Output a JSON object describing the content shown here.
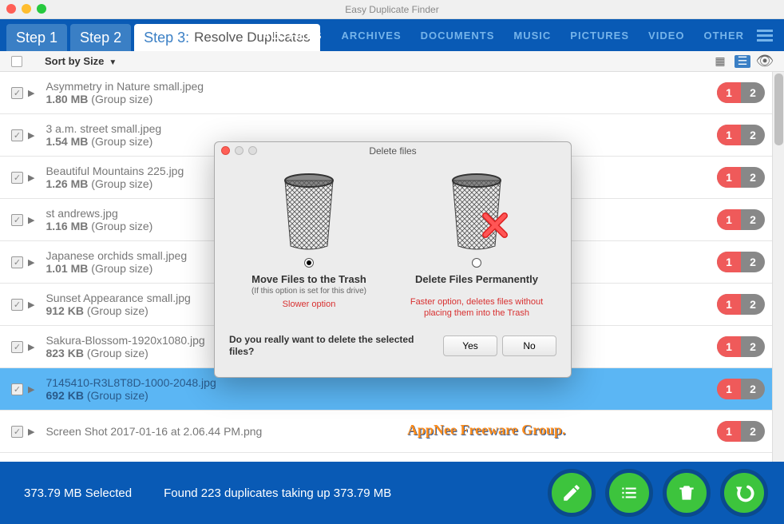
{
  "app_title": "Easy Duplicate Finder",
  "steps": [
    {
      "label": "Step 1"
    },
    {
      "label": "Step 2"
    },
    {
      "label": "Step 3:",
      "sublabel": "Resolve Duplicates",
      "active": true
    }
  ],
  "categories": [
    "ALL FILES",
    "ARCHIVES",
    "DOCUMENTS",
    "MUSIC",
    "PICTURES",
    "VIDEO",
    "OTHER"
  ],
  "sort_label": "Sort by Size",
  "files": [
    {
      "name": "Asymmetry in Nature small.jpeg",
      "size": "1.80 MB",
      "gs": "(Group size)",
      "p1": "1",
      "p2": "2"
    },
    {
      "name": "3 a.m. street small.jpeg",
      "size": "1.54 MB",
      "gs": "(Group size)",
      "p1": "1",
      "p2": "2"
    },
    {
      "name": "Beautiful Mountains 225.jpg",
      "size": "1.26 MB",
      "gs": "(Group size)",
      "p1": "1",
      "p2": "2"
    },
    {
      "name": "st andrews.jpg",
      "size": "1.16 MB",
      "gs": "(Group size)",
      "p1": "1",
      "p2": "2"
    },
    {
      "name": "Japanese orchids small.jpeg",
      "size": "1.01 MB",
      "gs": "(Group size)",
      "p1": "1",
      "p2": "2"
    },
    {
      "name": "Sunset Appearance small.jpg",
      "size": "912 KB",
      "gs": "(Group size)",
      "p1": "1",
      "p2": "2"
    },
    {
      "name": "Sakura-Blossom-1920x1080.jpg",
      "size": "823 KB",
      "gs": "(Group size)",
      "p1": "1",
      "p2": "2"
    },
    {
      "name": "7145410-R3L8T8D-1000-2048.jpg",
      "size": "692 KB",
      "gs": "(Group size)",
      "p1": "1",
      "p2": "2",
      "selected": true
    },
    {
      "name": "Screen Shot 2017-01-16 at 2.06.44 PM.png",
      "size": "",
      "gs": "",
      "p1": "1",
      "p2": "2"
    }
  ],
  "watermark": "AppNee Freeware Group.",
  "selected_info": "373.79 MB Selected",
  "duplicate_info": "Found 223 duplicates taking up 373.79 MB",
  "modal": {
    "title": "Delete files",
    "opt1": {
      "label": "Move Files to the Trash",
      "sub": "(If this option is set for this drive)",
      "warn": "Slower option"
    },
    "opt2": {
      "label": "Delete Files Permanently",
      "warn": "Faster option, deletes files without placing them into the Trash"
    },
    "prompt": "Do you really want to delete the selected files?",
    "yes": "Yes",
    "no": "No"
  }
}
